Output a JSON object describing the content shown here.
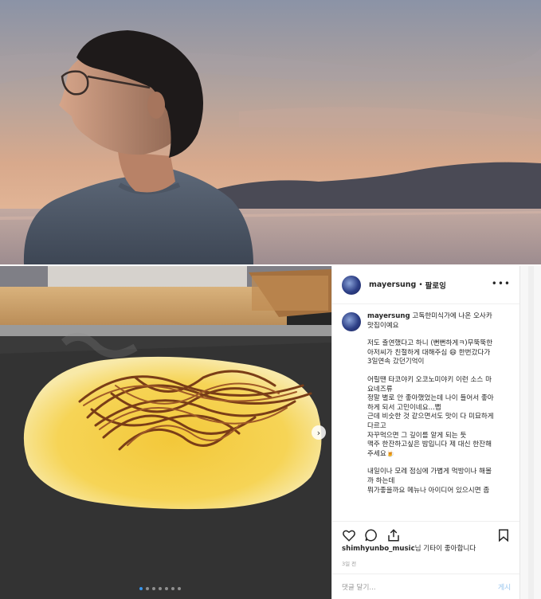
{
  "post": {
    "username": "mayersung",
    "separator": "•",
    "follow_label": "팔로잉",
    "more_icon": "more-icon"
  },
  "caption": {
    "username": "mayersung",
    "lines": [
      "고독한미식가에 나온 오사카",
      "맛집이예요",
      "",
      "저도 출연했다고 하니 (뻔뻔하게ㅋ)무뚝뚝한",
      "아저씨가 친절하게 대해주심 😄 한번갔다가",
      "3일연속 갔던기억이",
      "",
      "어릴땐 타코야키 오코노미야키 이런 소스 마",
      "요네즈류",
      "정말 별로 안 좋아했었는데 나이 들어서 좋아",
      "하게 되서 고민이네요...뻡",
      "근데 비슷한 것 같으면서도 맛이 다 미묘하게",
      "다르고",
      "자꾸먹으면 그 깊이를 알게 되는 듯",
      "맥주 한잔하고싶은 밤입니다 제 대신 한잔해",
      "주세요🍺",
      "",
      "내일이나 모레 점심에 가볍게 먹방이나 해볼",
      "까 하는데",
      "뭐가좋을까요 메뉴나 아이디어 있으시면 좀"
    ]
  },
  "comment": {
    "username": "shimhyunbo_music",
    "text": "님 기타이 좋아합니다"
  },
  "date": "3일 전",
  "add_comment": {
    "placeholder": "댓글 달기...",
    "post_label": "게시"
  },
  "icons": [
    "heart-icon",
    "comment-icon",
    "share-icon",
    "bookmark-icon",
    "next-arrow-icon"
  ],
  "colors": {
    "link_blue": "#3897f0",
    "text": "#262626",
    "muted": "#999999"
  }
}
